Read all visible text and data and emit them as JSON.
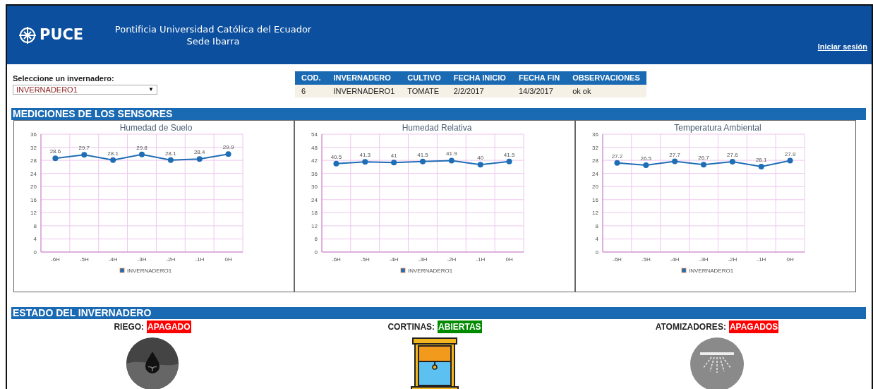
{
  "header": {
    "logo_text": "PUCE",
    "university": "Pontificia Universidad Católica del Ecuador",
    "campus": "Sede Ibarra",
    "login_link": "Iniciar sesión"
  },
  "selector": {
    "label": "Seleccione un invernadero:",
    "value": "INVERNADERO1",
    "arrow": "▼"
  },
  "info_table": {
    "columns": [
      "COD.",
      "INVERNADERO",
      "CULTIVO",
      "FECHA INICIO",
      "FECHA FIN",
      "OBSERVACIONES"
    ],
    "rows": [
      [
        "6",
        "INVERNADERO1",
        "TOMATE",
        "2/2/2017",
        "14/3/2017",
        "ok ok"
      ]
    ]
  },
  "sensors_section": {
    "title": "MEDICIONES DE LOS SENSORES",
    "charts": [
      {
        "chart_data": {
          "type": "line",
          "title": "Humedad de Suelo",
          "categories": [
            "-6H",
            "-5H",
            "-4H",
            "-3H",
            "-2H",
            "-1H",
            "0H"
          ],
          "series": [
            {
              "name": "INVERNADERO1",
              "color": "#1f6db5",
              "marker": "circle",
              "values": [
                28.6,
                29.7,
                28.1,
                29.8,
                28.1,
                28.4,
                29.9
              ]
            }
          ],
          "grid": true,
          "ylim": [
            0,
            36
          ],
          "yticks": [
            0,
            4,
            8,
            12,
            16,
            20,
            24,
            28,
            32,
            36
          ],
          "data_labels": true
        }
      },
      {
        "chart_data": {
          "type": "line",
          "title": "Humedad Relativa",
          "categories": [
            "-6H",
            "-5H",
            "-4H",
            "-3H",
            "-2H",
            "-1H",
            "0H"
          ],
          "series": [
            {
              "name": "INVERNADERO1",
              "color": "#1f6db5",
              "marker": "circle",
              "values": [
                40.5,
                41.3,
                41,
                41.5,
                41.9,
                40,
                41.5
              ]
            }
          ],
          "grid": true,
          "ylim": [
            0,
            54
          ],
          "yticks": [
            0,
            6,
            12,
            18,
            24,
            30,
            36,
            42,
            48,
            54
          ],
          "data_labels": true
        }
      },
      {
        "chart_data": {
          "type": "line",
          "title": "Temperatura Ambiental",
          "categories": [
            "-6H",
            "-5H",
            "-4H",
            "-3H",
            "-2H",
            "-1H",
            "0H"
          ],
          "series": [
            {
              "name": "INVERNADERO1",
              "color": "#1f6db5",
              "marker": "circle",
              "values": [
                27.2,
                26.5,
                27.7,
                26.7,
                27.6,
                26.1,
                27.9
              ]
            }
          ],
          "grid": true,
          "ylim": [
            0,
            36
          ],
          "yticks": [
            0,
            4,
            8,
            12,
            16,
            20,
            24,
            28,
            32,
            36
          ],
          "data_labels": true
        }
      }
    ]
  },
  "status_section": {
    "title": "ESTADO DEL INVERNADERO",
    "items": [
      {
        "kind": "irrigation",
        "label": "RIEGO:",
        "value": "APAGADO",
        "color": "#ff0000"
      },
      {
        "kind": "curtain",
        "label": "CORTINAS:",
        "value": "ABIERTAS",
        "color": "#008a00"
      },
      {
        "kind": "atomizer",
        "label": "ATOMIZADORES:",
        "value": "APAGADOS",
        "color": "#ff0000"
      }
    ]
  }
}
